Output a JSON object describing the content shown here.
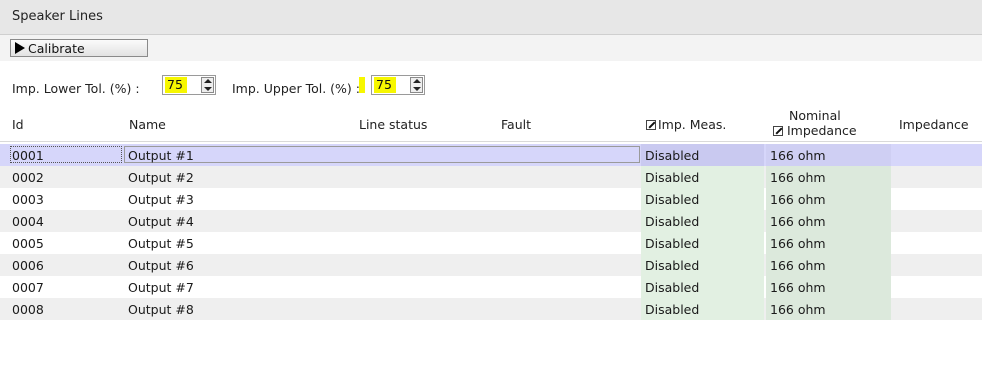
{
  "panel": {
    "title": "Speaker Lines"
  },
  "toolbar": {
    "calibrate_label": "Calibrate"
  },
  "tolerance": {
    "lower_label": "Imp. Lower Tol. (%) :",
    "lower_value": "75",
    "upper_label": "Imp. Upper Tol. (%) :",
    "upper_value": "75"
  },
  "table": {
    "headers": {
      "id": "Id",
      "name": "Name",
      "line_status": "Line status",
      "fault": "Fault",
      "imp_meas": "Imp. Meas.",
      "nominal_line1": "Nominal",
      "nominal_line2": "Impedance",
      "impedance": "Impedance"
    },
    "rows": [
      {
        "id": "0001",
        "name": "Output #1",
        "line_status": "",
        "fault": "",
        "imp_meas": "Disabled",
        "nominal": "166 ohm",
        "impedance": ""
      },
      {
        "id": "0002",
        "name": "Output #2",
        "line_status": "",
        "fault": "",
        "imp_meas": "Disabled",
        "nominal": "166 ohm",
        "impedance": ""
      },
      {
        "id": "0003",
        "name": "Output #3",
        "line_status": "",
        "fault": "",
        "imp_meas": "Disabled",
        "nominal": "166 ohm",
        "impedance": ""
      },
      {
        "id": "0004",
        "name": "Output #4",
        "line_status": "",
        "fault": "",
        "imp_meas": "Disabled",
        "nominal": "166 ohm",
        "impedance": ""
      },
      {
        "id": "0005",
        "name": "Output #5",
        "line_status": "",
        "fault": "",
        "imp_meas": "Disabled",
        "nominal": "166 ohm",
        "impedance": ""
      },
      {
        "id": "0006",
        "name": "Output #6",
        "line_status": "",
        "fault": "",
        "imp_meas": "Disabled",
        "nominal": "166 ohm",
        "impedance": ""
      },
      {
        "id": "0007",
        "name": "Output #7",
        "line_status": "",
        "fault": "",
        "imp_meas": "Disabled",
        "nominal": "166 ohm",
        "impedance": ""
      },
      {
        "id": "0008",
        "name": "Output #8",
        "line_status": "",
        "fault": "",
        "imp_meas": "Disabled",
        "nominal": "166 ohm",
        "impedance": ""
      }
    ],
    "selected_row": 0
  },
  "colors": {
    "highlight": "#f7f700",
    "selected_row": "#d6d6fa",
    "meas_cell": "#e2f0e2",
    "nominal_cell": "#dce9dc"
  }
}
